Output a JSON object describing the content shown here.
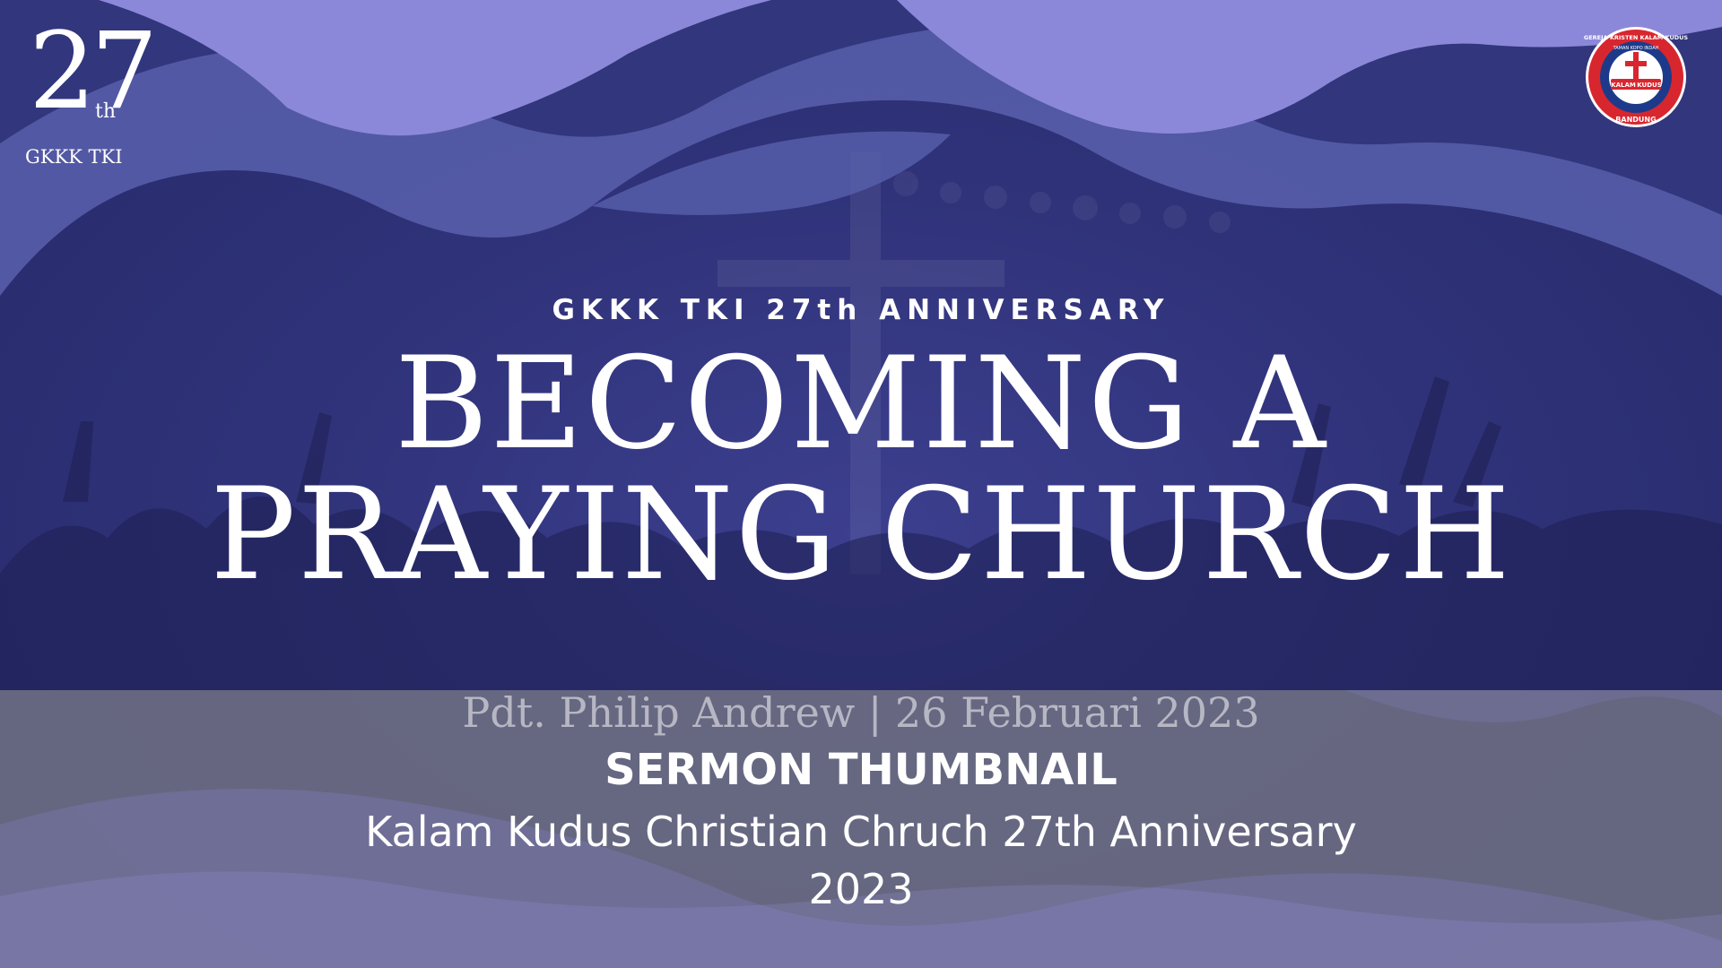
{
  "logo": {
    "number": "27",
    "ordinal": "th",
    "org": "GKKK TKI"
  },
  "seal": {
    "ring_text_top": "GEREJA KRISTEN KALAM KUDUS",
    "inner_text": "TAMAN KOPO INDAH",
    "banner_left": "KALAM",
    "banner_right": "KUDUS",
    "city": "BANDUNG"
  },
  "headline": {
    "subtitle": "GKKK TKI 27th ANNIVERSARY",
    "title_line1": "BECOMING A",
    "title_line2": "PRAYING CHURCH"
  },
  "caption": {
    "byline": "Pdt. Philip Andrew | 26 Februari 2023",
    "heading": "SERMON THUMBNAIL",
    "line1": "Kalam Kudus Christian Chruch 27th Anniversary",
    "line2": "2023"
  },
  "colors": {
    "background": "#30337a",
    "wave_light": "#8c88d9",
    "wave_mid": "#5960ad",
    "seal_red": "#d8262f",
    "seal_blue": "#1d3a8a"
  }
}
